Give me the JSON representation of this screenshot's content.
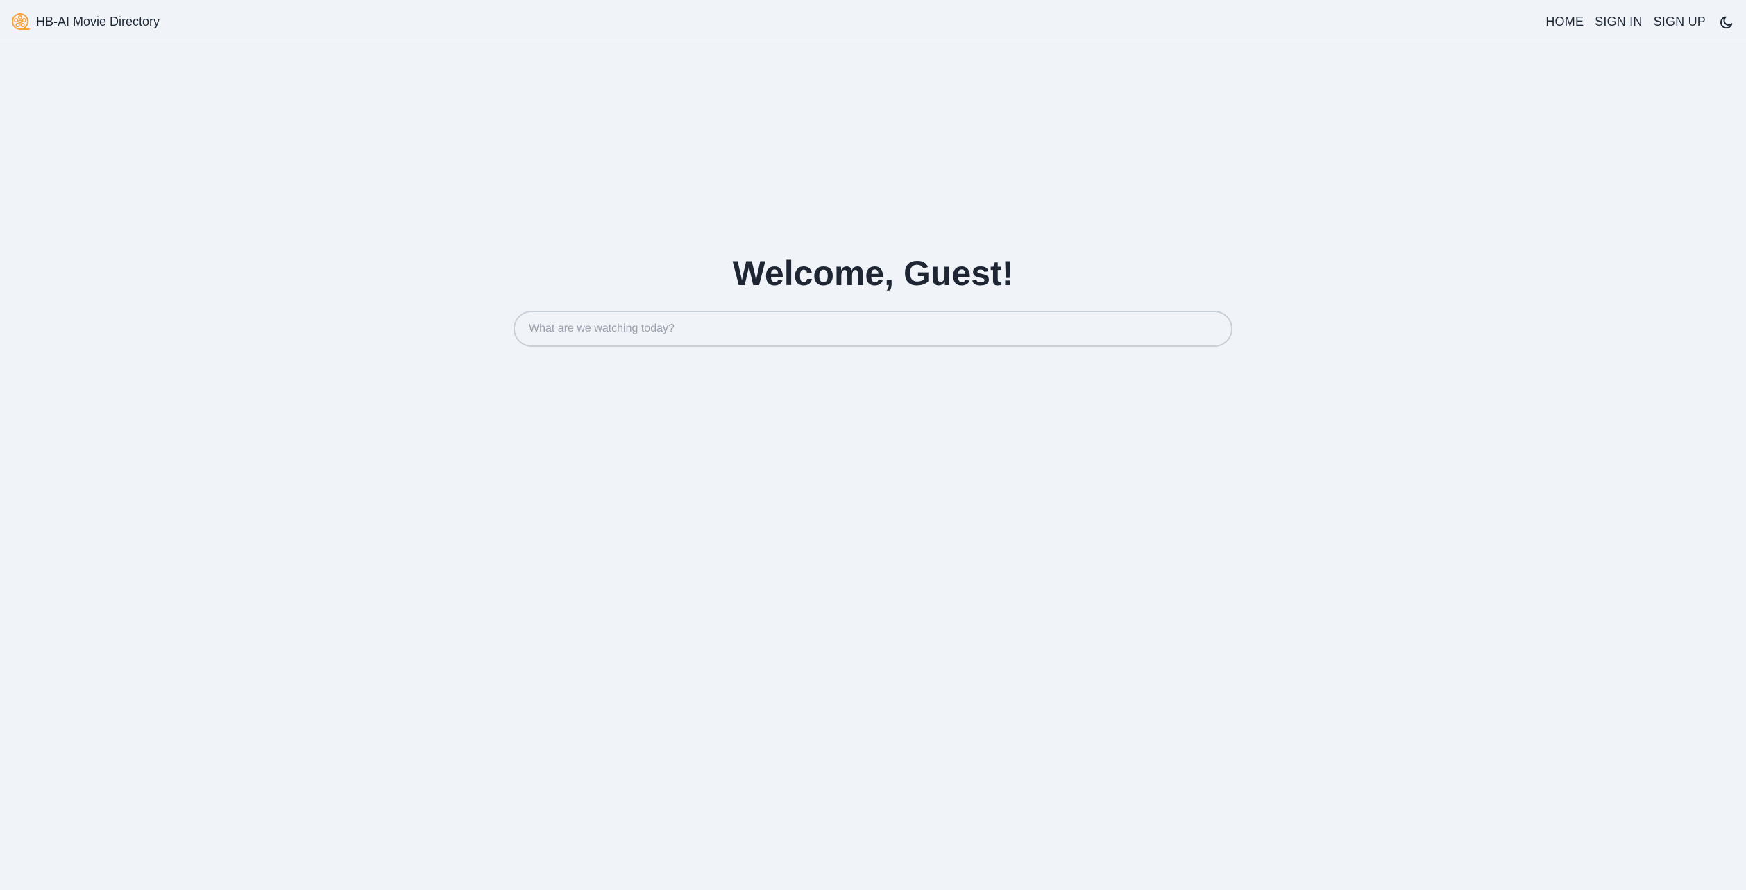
{
  "header": {
    "brand_name": "HB-AI Movie Directory",
    "brand_icon": "film-reel-icon",
    "nav": [
      {
        "label": "HOME"
      },
      {
        "label": "SIGN IN"
      },
      {
        "label": "SIGN UP"
      }
    ],
    "theme_icon": "moon-icon"
  },
  "main": {
    "welcome": "Welcome, Guest!",
    "search": {
      "placeholder": "What are we watching today?",
      "value": ""
    }
  },
  "colors": {
    "background": "#f0f4f8",
    "text": "#1f2937",
    "accent": "#f6a03c"
  }
}
